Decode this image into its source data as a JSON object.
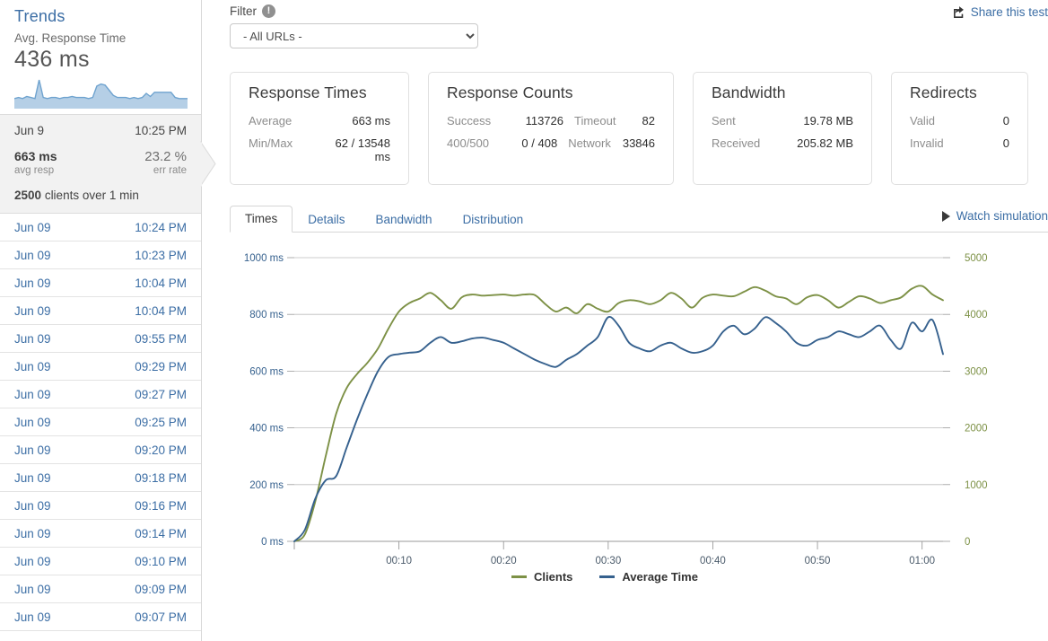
{
  "sidebar": {
    "title": "Trends",
    "metric_label": "Avg. Response Time",
    "metric_value": "436 ms",
    "sparkline_points": [
      8,
      9,
      8,
      10,
      9,
      8,
      26,
      9,
      8,
      9,
      9,
      8,
      9,
      9,
      10,
      9,
      9,
      9,
      8,
      9,
      20,
      22,
      21,
      16,
      11,
      9,
      9,
      9,
      8,
      9,
      8,
      9,
      13,
      10,
      14,
      14,
      14,
      14,
      14,
      9,
      8,
      8,
      8
    ],
    "selected": {
      "date": "Jun 9",
      "time": "10:25 PM",
      "avg_resp_value": "663 ms",
      "avg_resp_label": "avg resp",
      "err_rate_value": "23.2 %",
      "err_rate_label": "err rate",
      "clients_value": "2500",
      "clients_text": "clients over 1 min"
    },
    "runs": [
      {
        "date": "Jun 09",
        "time": "10:24 PM"
      },
      {
        "date": "Jun 09",
        "time": "10:23 PM"
      },
      {
        "date": "Jun 09",
        "time": "10:04 PM"
      },
      {
        "date": "Jun 09",
        "time": "10:04 PM"
      },
      {
        "date": "Jun 09",
        "time": "09:55 PM"
      },
      {
        "date": "Jun 09",
        "time": "09:29 PM"
      },
      {
        "date": "Jun 09",
        "time": "09:27 PM"
      },
      {
        "date": "Jun 09",
        "time": "09:25 PM"
      },
      {
        "date": "Jun 09",
        "time": "09:20 PM"
      },
      {
        "date": "Jun 09",
        "time": "09:18 PM"
      },
      {
        "date": "Jun 09",
        "time": "09:16 PM"
      },
      {
        "date": "Jun 09",
        "time": "09:14 PM"
      },
      {
        "date": "Jun 09",
        "time": "09:10 PM"
      },
      {
        "date": "Jun 09",
        "time": "09:09 PM"
      },
      {
        "date": "Jun 09",
        "time": "09:07 PM"
      }
    ]
  },
  "topbar": {
    "filter_label": "Filter",
    "filter_info_icon": "info-icon",
    "url_selected": "- All URLs -",
    "share_label": "Share this test",
    "share_icon": "share-icon"
  },
  "cards": {
    "response_times": {
      "title": "Response Times",
      "rows": [
        {
          "label": "Average",
          "value": "663 ms"
        },
        {
          "label": "Min/Max",
          "value": "62 / 13548 ms"
        }
      ]
    },
    "response_counts": {
      "title": "Response Counts",
      "rows": [
        {
          "label": "Success",
          "value": "113726",
          "label2": "Timeout",
          "value2": "82"
        },
        {
          "label": "400/500",
          "value": "0 / 408",
          "label2": "Network",
          "value2": "33846"
        }
      ]
    },
    "bandwidth": {
      "title": "Bandwidth",
      "rows": [
        {
          "label": "Sent",
          "value": "19.78 MB"
        },
        {
          "label": "Received",
          "value": "205.82 MB"
        }
      ]
    },
    "redirects": {
      "title": "Redirects",
      "rows": [
        {
          "label": "Valid",
          "value": "0"
        },
        {
          "label": "Invalid",
          "value": "0"
        }
      ]
    }
  },
  "tabs": {
    "items": [
      {
        "label": "Times",
        "active": true
      },
      {
        "label": "Details",
        "active": false
      },
      {
        "label": "Bandwidth",
        "active": false
      },
      {
        "label": "Distribution",
        "active": false
      }
    ],
    "watch_label": "Watch simulation",
    "watch_icon": "play-icon"
  },
  "chart_data": {
    "type": "line",
    "title": "",
    "xlabel": "",
    "ylabel": "",
    "grid": true,
    "legend_position": "bottom",
    "x_ticks": [
      "00:10",
      "00:20",
      "00:30",
      "00:40",
      "00:50",
      "01:00"
    ],
    "x_tick_seconds": [
      10,
      20,
      30,
      40,
      50,
      60
    ],
    "xlim": [
      0,
      62
    ],
    "left_axis": {
      "label_suffix": "ms",
      "ticks": [
        "0 ms",
        "200 ms",
        "400 ms",
        "600 ms",
        "800 ms",
        "1000 ms"
      ],
      "tick_values": [
        0,
        200,
        400,
        600,
        800,
        1000
      ],
      "ylim": [
        0,
        1000
      ],
      "color": "#36618e"
    },
    "right_axis": {
      "ticks": [
        "0",
        "1000",
        "2000",
        "3000",
        "4000",
        "5000"
      ],
      "tick_values": [
        0,
        1000,
        2000,
        3000,
        4000,
        5000
      ],
      "ylim": [
        0,
        5000
      ],
      "color": "#7d9146"
    },
    "series": [
      {
        "name": "Clients",
        "color": "#7d9146",
        "axis": "right",
        "values": [
          0,
          120,
          700,
          1500,
          2250,
          2700,
          2950,
          3150,
          3400,
          3750,
          4050,
          4200,
          4280,
          4380,
          4250,
          4100,
          4300,
          4350,
          4330,
          4340,
          4350,
          4330,
          4350,
          4340,
          4180,
          4050,
          4120,
          4020,
          4180,
          4100,
          4050,
          4200,
          4250,
          4230,
          4180,
          4250,
          4380,
          4280,
          4120,
          4290,
          4350,
          4330,
          4320,
          4400,
          4480,
          4420,
          4320,
          4280,
          4180,
          4300,
          4340,
          4250,
          4120,
          4220,
          4320,
          4280,
          4200,
          4250,
          4300,
          4450,
          4500,
          4350,
          4250
        ]
      },
      {
        "name": "Average Time",
        "color": "#36618e",
        "axis": "left",
        "values": [
          0,
          40,
          150,
          215,
          230,
          330,
          430,
          520,
          600,
          650,
          660,
          665,
          670,
          700,
          720,
          700,
          705,
          715,
          718,
          710,
          700,
          680,
          660,
          640,
          625,
          615,
          640,
          660,
          690,
          720,
          790,
          760,
          700,
          680,
          670,
          690,
          700,
          680,
          665,
          670,
          690,
          740,
          760,
          730,
          750,
          790,
          770,
          740,
          700,
          690,
          710,
          720,
          740,
          730,
          720,
          740,
          760,
          710,
          680,
          770,
          740,
          780,
          660
        ]
      }
    ]
  }
}
